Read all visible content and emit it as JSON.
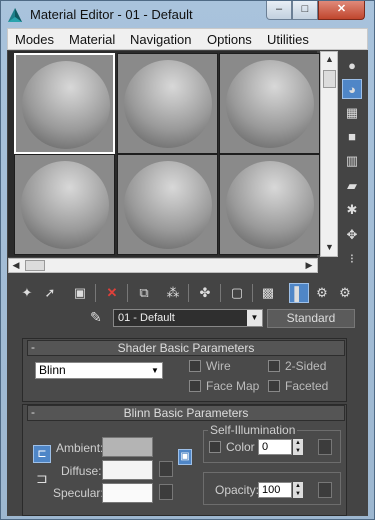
{
  "window": {
    "title": "Material Editor - 01 - Default",
    "min_label": "–",
    "max_label": "□",
    "close_label": "✕"
  },
  "menubar": {
    "items": [
      "Modes",
      "Material",
      "Navigation",
      "Options",
      "Utilities"
    ]
  },
  "material": {
    "name": "01 - Default",
    "type": "Standard"
  },
  "shader_rollout": {
    "title": "Shader Basic Parameters",
    "collapse_label": "-",
    "shader": "Blinn",
    "checkboxes": {
      "wire": "Wire",
      "two_sided": "2-Sided",
      "face_map": "Face Map",
      "faceted": "Faceted"
    }
  },
  "blinn_rollout": {
    "title": "Blinn Basic Parameters",
    "collapse_label": "-",
    "ambient_label": "Ambient:",
    "diffuse_label": "Diffuse:",
    "specular_label": "Specular:",
    "self_illum_title": "Self-Illumination",
    "color_label": "Color",
    "color_value": "0",
    "opacity_label": "Opacity:",
    "opacity_value": "100"
  },
  "colors": {
    "accent": "#4f86c7",
    "panel_bg": "#444444",
    "ambient_swatch": "#b4b4b4",
    "diffuse_swatch": "#f4f4f4",
    "specular_swatch": "#fafafa"
  }
}
